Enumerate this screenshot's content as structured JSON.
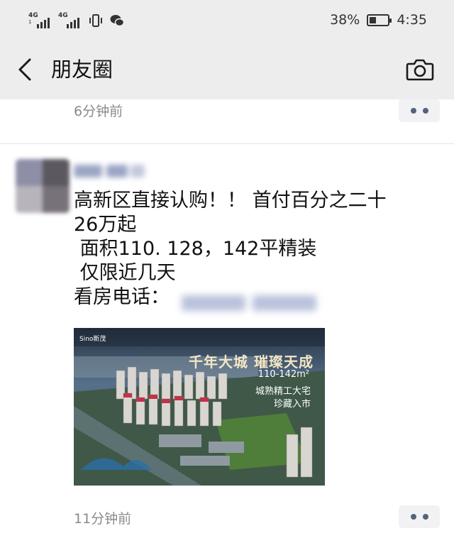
{
  "status_bar": {
    "signal1": {
      "tag": "4G",
      "sub": "1"
    },
    "signal2": {
      "tag": "4G"
    },
    "battery_percent_text": "38%",
    "battery_level": 0.38,
    "time": "4:35"
  },
  "nav": {
    "title": "朋友圈",
    "back_icon": "chevron-left-icon",
    "camera_icon": "camera-icon"
  },
  "feed": {
    "prev_post": {
      "time": "6分钟前"
    },
    "post": {
      "text": "高新区直接认购！！ 首付百分之二十\n26万起\n 面积110. 128，142平精装\n 仅限近几天\n看房电话：",
      "image": {
        "logo": "Sino新茂",
        "headline": "千年大城 璀璨天成",
        "area": "110-142m²",
        "line1": "城熟精工大宅",
        "line2": "珍藏入市"
      },
      "time": "11分钟前"
    }
  },
  "colors": {
    "header_bg": "#ededed",
    "time_text": "#8a8a8a",
    "more_dots": "#55627c"
  }
}
